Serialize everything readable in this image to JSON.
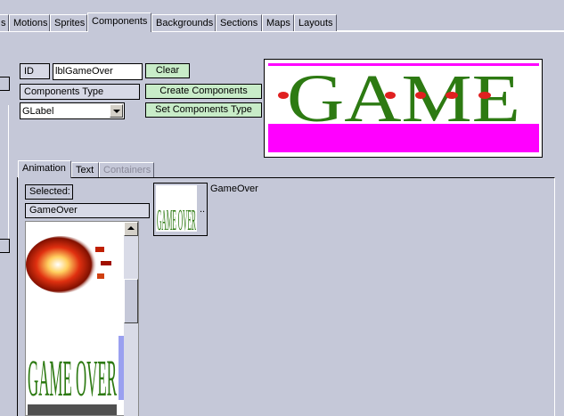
{
  "tabs": [
    {
      "label": "s"
    },
    {
      "label": "Motions"
    },
    {
      "label": "Sprites"
    },
    {
      "label": "Components"
    },
    {
      "label": "Backgrounds"
    },
    {
      "label": "Sections"
    },
    {
      "label": "Maps"
    },
    {
      "label": "Layouts"
    }
  ],
  "form": {
    "id_label": "ID",
    "id_value": "lblGameOver",
    "clear_label": "Clear",
    "components_type_label": "Components Type",
    "create_components_label": "Create Components",
    "type_value": "GLabel",
    "set_components_type_label": "Set Components Type"
  },
  "preview": {
    "text": "GAME",
    "colors": {
      "letters": "#2d7a12",
      "dots": "#e02020",
      "band": "#ff00ff"
    }
  },
  "subtabs": [
    {
      "label": "Animation"
    },
    {
      "label": "Text"
    },
    {
      "label": "Containers"
    }
  ],
  "animation": {
    "selected_label": "Selected:",
    "selected_value": "GameOver",
    "sprite_name": "GameOver",
    "ellipsis": "..",
    "list_art_text": "GAME OVER",
    "thumb_text": "GAME OVER"
  }
}
